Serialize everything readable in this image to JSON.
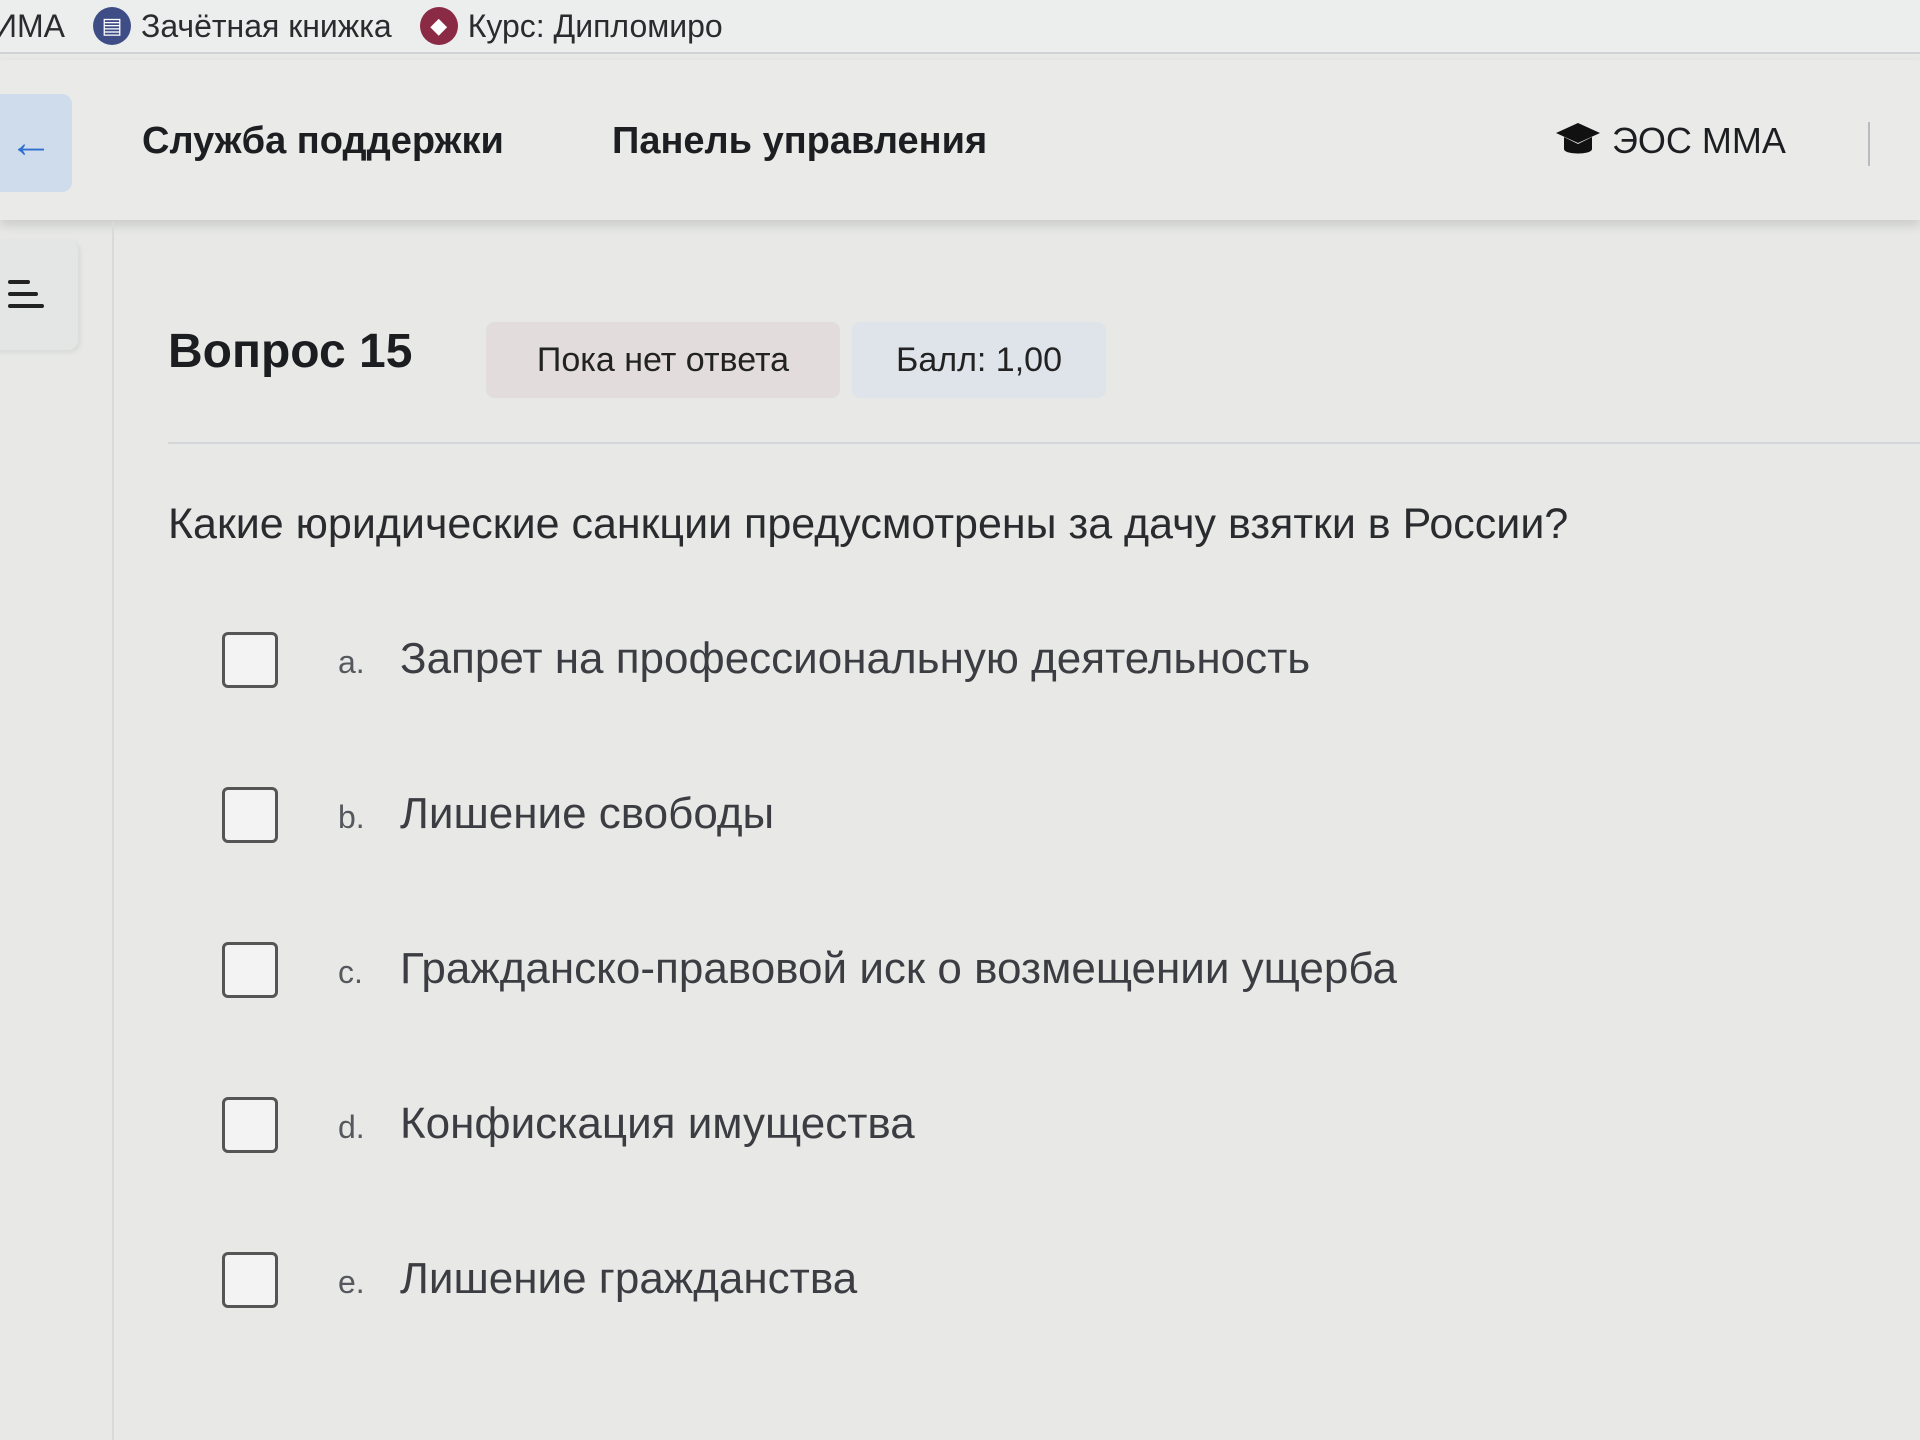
{
  "bookmarks": [
    {
      "label": "ИМА",
      "icon": ""
    },
    {
      "label": "Зачётная книжка",
      "icon": "book-icon"
    },
    {
      "label": "Курс: Дипломиро",
      "icon": "course-icon"
    }
  ],
  "nav": {
    "back_icon": "←",
    "support": "Служба поддержки",
    "dashboard": "Панель управления",
    "brand": "ЭОС ММА",
    "brand_icon": "graduation-cap-icon"
  },
  "question": {
    "title": "Вопрос 15",
    "status": "Пока нет ответа",
    "score": "Балл: 1,00",
    "text": "Какие юридические санкции предусмотрены за дачу взятки в России?",
    "options": [
      {
        "letter": "a.",
        "text": "Запрет на профессиональную деятельность",
        "checked": false
      },
      {
        "letter": "b.",
        "text": "Лишение свободы",
        "checked": false
      },
      {
        "letter": "c.",
        "text": "Гражданско-правовой иск о возмещении ущерба",
        "checked": false
      },
      {
        "letter": "d.",
        "text": "Конфискация имущества",
        "checked": false
      },
      {
        "letter": "e.",
        "text": "Лишение гражданства",
        "checked": false
      }
    ]
  },
  "colors": {
    "accent": "#2f6fcf",
    "status_badge_bg": "#e2dcdc",
    "score_badge_bg": "#dfe3ea"
  }
}
